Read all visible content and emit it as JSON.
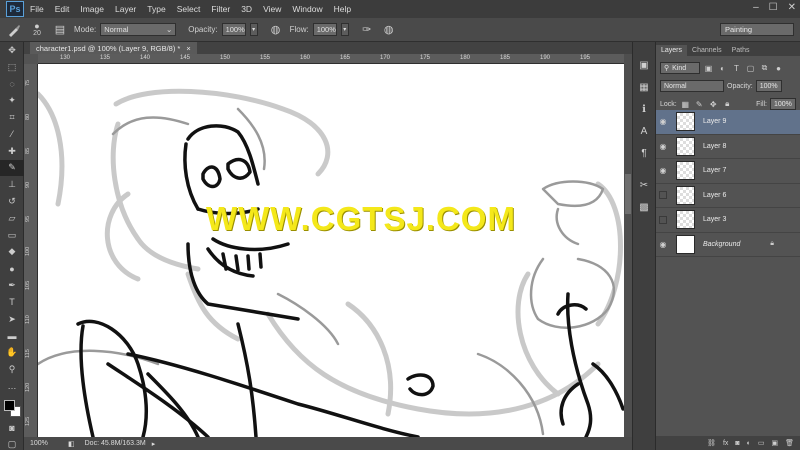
{
  "app": {
    "logo_text": "Ps",
    "menu": [
      "File",
      "Edit",
      "Image",
      "Layer",
      "Type",
      "Select",
      "Filter",
      "3D",
      "View",
      "Window",
      "Help"
    ],
    "window_controls": [
      "–",
      "☐",
      "✕"
    ]
  },
  "options_bar": {
    "brush_size": "20",
    "mode_label": "Mode:",
    "mode_value": "Normal",
    "opacity_label": "Opacity:",
    "opacity_value": "100%",
    "flow_label": "Flow:",
    "flow_value": "100%",
    "workspace": "Painting"
  },
  "document": {
    "tab_title": "character1.psd @ 100% (Layer 9, RGB/8) *",
    "close_glyph": "×",
    "ruler_ticks": [
      "130",
      "135",
      "140",
      "145",
      "150",
      "155",
      "160",
      "165",
      "170",
      "175",
      "180",
      "185",
      "190",
      "195"
    ],
    "vruler_ticks": [
      "75",
      "80",
      "85",
      "90",
      "95",
      "100",
      "105",
      "110",
      "115",
      "120",
      "125"
    ],
    "watermark": "WWW.CGTSJ.COM"
  },
  "status_bar": {
    "zoom": "100%",
    "doc_info": "Doc: 45.8M/163.3M"
  },
  "layers_panel": {
    "tabs": [
      "Layers",
      "Channels",
      "Paths"
    ],
    "filter_label": "Kind",
    "blend_mode": "Normal",
    "opacity_label": "Opacity:",
    "opacity_value": "100%",
    "lock_label": "Lock:",
    "fill_label": "Fill:",
    "fill_value": "100%",
    "layers": [
      {
        "name": "Layer 9",
        "visible": true,
        "selected": true
      },
      {
        "name": "Layer 8",
        "visible": true,
        "selected": false
      },
      {
        "name": "Layer 7",
        "visible": true,
        "selected": false
      },
      {
        "name": "Layer 6",
        "visible": false,
        "selected": false
      },
      {
        "name": "Layer 3",
        "visible": false,
        "selected": false
      },
      {
        "name": "Background",
        "visible": true,
        "selected": false,
        "locked": true
      }
    ]
  },
  "colors": {
    "foreground": "#000000",
    "background": "#ffffff",
    "selected_layer": "#61728b",
    "watermark": "#f4e81a"
  }
}
